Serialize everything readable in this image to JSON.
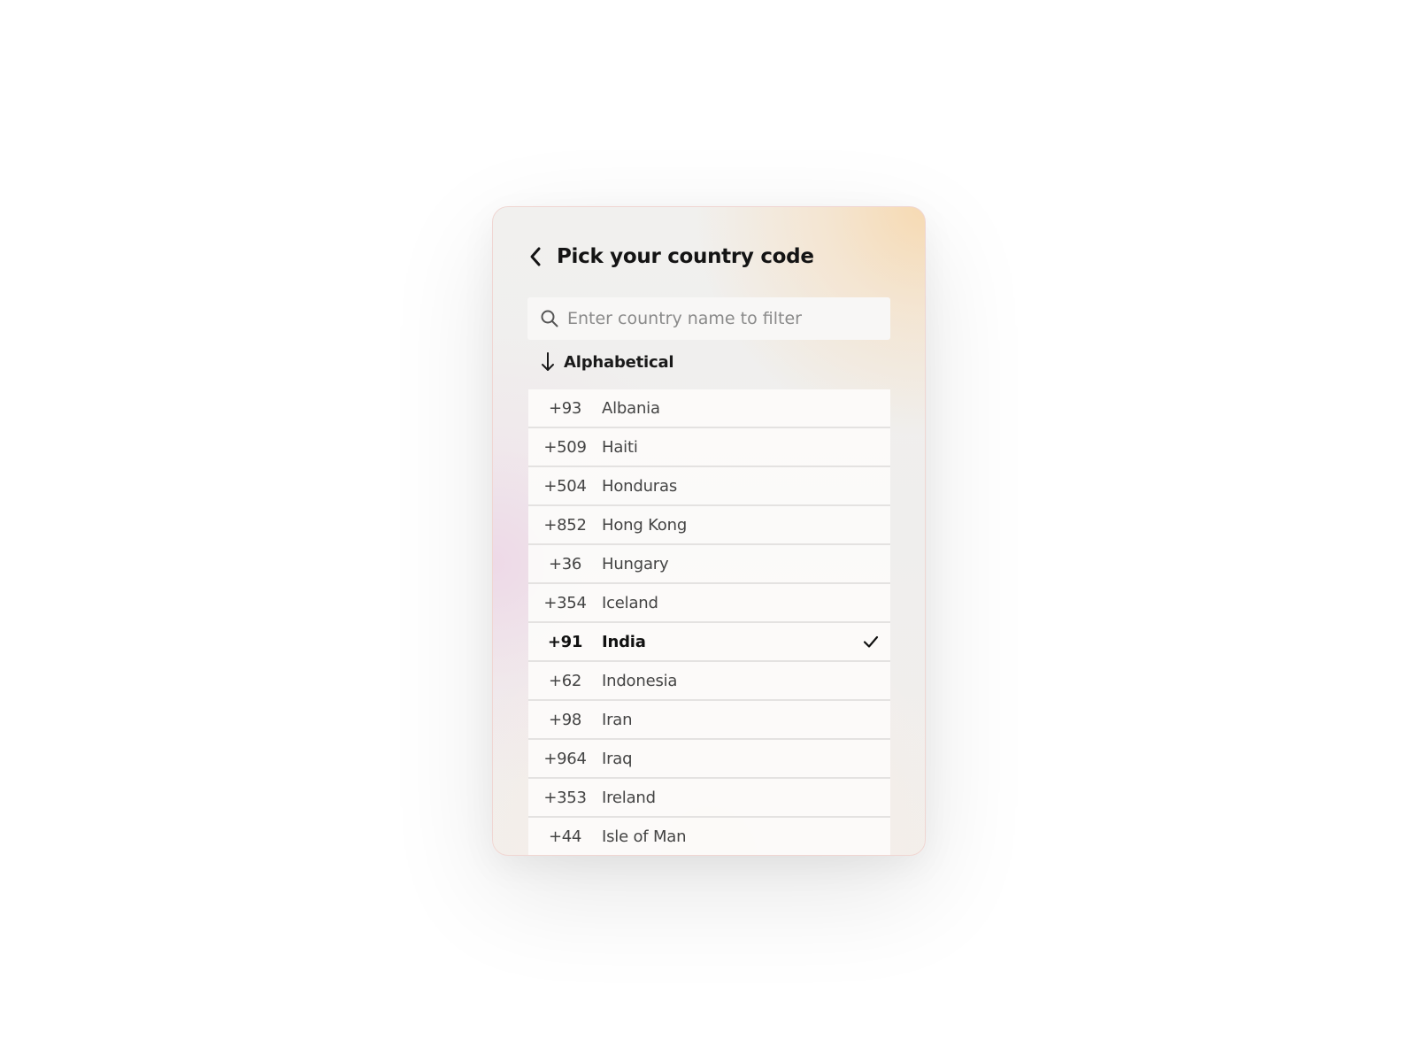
{
  "header": {
    "title": "Pick your country code",
    "back_icon": "chevron-left-icon"
  },
  "search": {
    "placeholder": "Enter country name to filter",
    "value": "",
    "icon": "search-icon"
  },
  "sort": {
    "label": "Alphabetical",
    "icon": "arrow-down-icon"
  },
  "countries": [
    {
      "code": "+93",
      "name": "Albania",
      "selected": false
    },
    {
      "code": "+509",
      "name": "Haiti",
      "selected": false
    },
    {
      "code": "+504",
      "name": "Honduras",
      "selected": false
    },
    {
      "code": "+852",
      "name": "Hong Kong",
      "selected": false
    },
    {
      "code": "+36",
      "name": "Hungary",
      "selected": false
    },
    {
      "code": "+354",
      "name": "Iceland",
      "selected": false
    },
    {
      "code": "+91",
      "name": "India",
      "selected": true
    },
    {
      "code": "+62",
      "name": "Indonesia",
      "selected": false
    },
    {
      "code": "+98",
      "name": "Iran",
      "selected": false
    },
    {
      "code": "+964",
      "name": "Iraq",
      "selected": false
    },
    {
      "code": "+353",
      "name": "Ireland",
      "selected": false
    },
    {
      "code": "+44",
      "name": "Isle of Man",
      "selected": false
    }
  ],
  "colors": {
    "text_primary": "#141414",
    "text_secondary": "#444444",
    "placeholder": "#8a8a8a",
    "accent_peach": "#f7d6a8",
    "accent_pink": "#ecc8e2"
  }
}
